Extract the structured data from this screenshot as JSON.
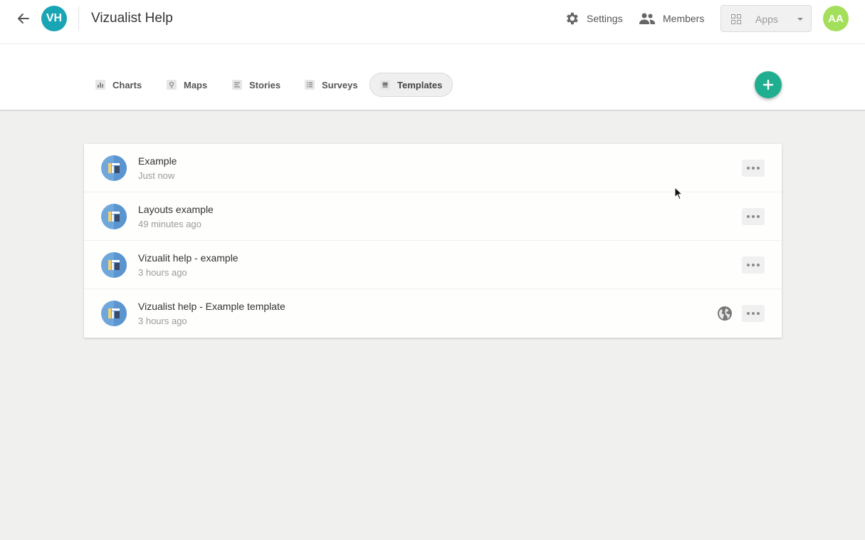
{
  "header": {
    "workspace_initials": "VH",
    "workspace_color": "#1aa5b5",
    "title": "Vizualist Help",
    "settings_label": "Settings",
    "members_label": "Members",
    "apps_label": "Apps",
    "user_initials": "AA",
    "user_color": "#a3df5a",
    "icons": [
      "back-arrow-icon",
      "gear-icon",
      "people-icon",
      "grid-icon",
      "chevron-down-icon"
    ]
  },
  "tabs": [
    {
      "label": "Charts",
      "icon": "bar-chart-icon",
      "active": false
    },
    {
      "label": "Maps",
      "icon": "map-pin-icon",
      "active": false
    },
    {
      "label": "Stories",
      "icon": "story-icon",
      "active": false
    },
    {
      "label": "Surveys",
      "icon": "survey-list-icon",
      "active": false
    },
    {
      "label": "Templates",
      "icon": "template-icon",
      "active": true
    }
  ],
  "add_button_color": "#1fae8f",
  "templates": [
    {
      "title": "Example",
      "time": "Just now",
      "published": false
    },
    {
      "title": "Layouts example",
      "time": "49 minutes ago",
      "published": false
    },
    {
      "title": "Vizualit help - example",
      "time": "3 hours ago",
      "published": false
    },
    {
      "title": "Vizualist help - Example template",
      "time": "3 hours ago",
      "published": true
    }
  ]
}
